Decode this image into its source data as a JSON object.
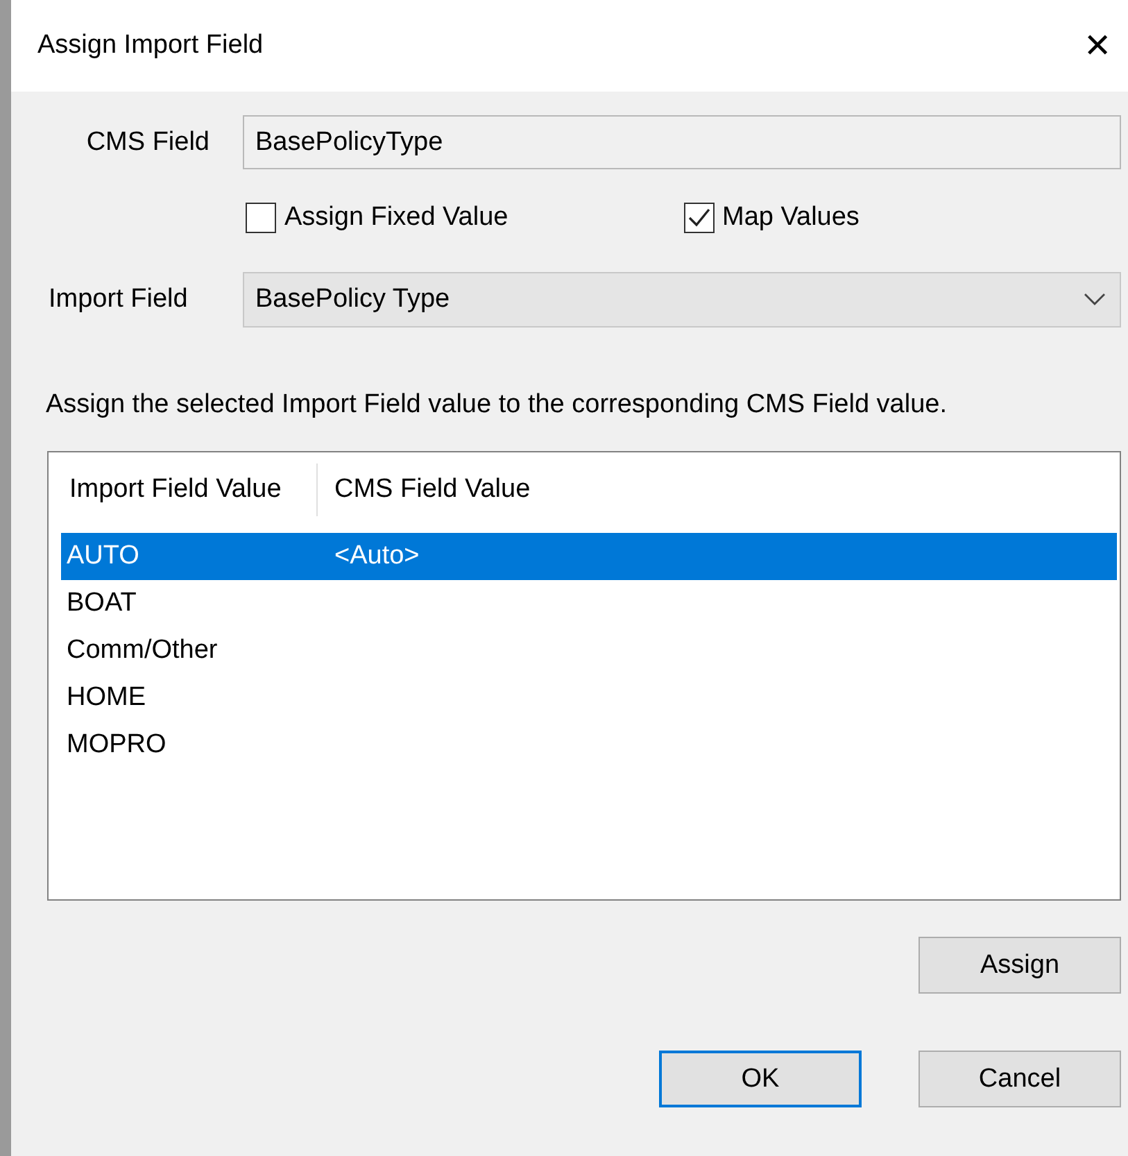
{
  "window": {
    "title": "Assign Import Field",
    "close": "✕"
  },
  "cms_field": {
    "label": "CMS Field",
    "value": "BasePolicyType"
  },
  "checkboxes": [
    {
      "label": "Assign Fixed Value",
      "checked": false
    },
    {
      "label": "Map Values",
      "checked": true
    }
  ],
  "import_field": {
    "label": "Import Field",
    "value": "BasePolicy Type"
  },
  "instruction": "Assign the selected Import Field value to the corresponding CMS Field value.",
  "table": {
    "columns": [
      "Import Field Value",
      "CMS Field Value"
    ],
    "rows": [
      {
        "cells": [
          "AUTO",
          "<Auto>"
        ],
        "selected": true
      },
      {
        "cells": [
          "BOAT",
          ""
        ],
        "selected": false
      },
      {
        "cells": [
          "Comm/Other",
          ""
        ],
        "selected": false
      },
      {
        "cells": [
          "HOME",
          ""
        ],
        "selected": false
      },
      {
        "cells": [
          "MOPRO",
          ""
        ],
        "selected": false
      }
    ]
  },
  "assign_button": "Assign",
  "buttons": [
    {
      "label": "OK",
      "default": true
    },
    {
      "label": "Cancel",
      "default": false
    }
  ]
}
